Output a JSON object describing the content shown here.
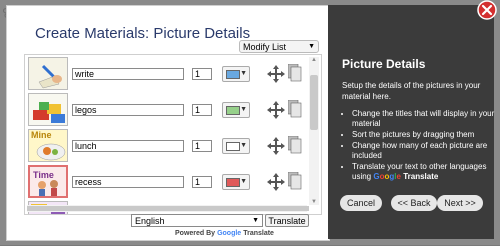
{
  "dialog": {
    "title": "Create Materials: Picture Details",
    "modify_select": {
      "value": "Modify List"
    },
    "rows": [
      {
        "name": "write",
        "count": "1",
        "color": "#69a8e0"
      },
      {
        "name": "legos",
        "count": "1",
        "color": "#96d08a"
      },
      {
        "name": "lunch",
        "count": "1",
        "color": "#ffffff"
      },
      {
        "name": "recess",
        "count": "1",
        "color": "#e05a5a"
      }
    ],
    "thumb_labels": {
      "lunch": "Mine",
      "recess": "Time"
    },
    "language_select": {
      "value": "English"
    },
    "translate_button": "Translate",
    "powered_by": {
      "prefix": "Powered By",
      "google": "Google",
      "suffix": "Translate"
    }
  },
  "panel": {
    "title": "Picture Details",
    "intro": "Setup the details of the pictures in your material here.",
    "bullets": [
      "Change the titles that will display in your material",
      "Sort the pictures by dragging them",
      "Change how many of each picture are included"
    ],
    "translate_bullet": {
      "prefix": "Translate your text to other languages using",
      "google": "Google",
      "suffix": "Translate"
    },
    "buttons": {
      "cancel": "Cancel",
      "back": "<< Back",
      "next": "Next >>"
    }
  },
  "icons": {
    "move": "move-arrows-icon",
    "copy": "copy-icon",
    "close": "close-icon",
    "caret": "chevron-down-icon"
  }
}
